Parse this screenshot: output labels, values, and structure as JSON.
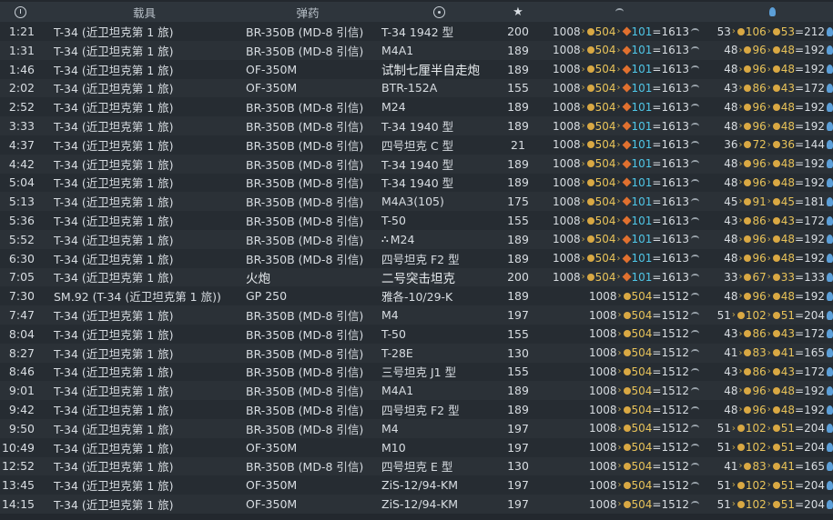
{
  "headers": {
    "vehicle": "载具",
    "ammo": "弹药"
  },
  "icons": {
    "time": "clock-icon",
    "target": "crosshair-icon",
    "score": "star-icon",
    "silver": "eagle-icon",
    "research": "lightbulb-icon"
  },
  "colors": {
    "bg": "#23282e",
    "silver_coin": "#d9a843",
    "premium": "#e0702f",
    "blue_bonus": "#4fc7e8"
  },
  "rows": [
    {
      "time": "1:21",
      "vehicle": "T-34 (近卫坦克第 1 旅)",
      "ammo": "BR-350B (MD-8 引信)",
      "target": "T-34 1942 型",
      "score": "200",
      "sl_base": "1008",
      "sl_bonus": "504",
      "sl_prem": "101",
      "sl_total": "=1613",
      "rp_base": "53",
      "rp_bonus": "106",
      "rp_prem": "53",
      "rp_total": "=212"
    },
    {
      "time": "1:31",
      "vehicle": "T-34 (近卫坦克第 1 旅)",
      "ammo": "BR-350B (MD-8 引信)",
      "target": "M4A1",
      "score": "189",
      "sl_base": "1008",
      "sl_bonus": "504",
      "sl_prem": "101",
      "sl_total": "=1613",
      "rp_base": "48",
      "rp_bonus": "96",
      "rp_prem": "48",
      "rp_total": "=192"
    },
    {
      "time": "1:46",
      "vehicle": "T-34 (近卫坦克第 1 旅)",
      "ammo": "OF-350M",
      "target": "试制七厘半自走炮",
      "big": true,
      "score": "189",
      "sl_base": "1008",
      "sl_bonus": "504",
      "sl_prem": "101",
      "sl_total": "=1613",
      "rp_base": "48",
      "rp_bonus": "96",
      "rp_prem": "48",
      "rp_total": "=192"
    },
    {
      "time": "2:02",
      "vehicle": "T-34 (近卫坦克第 1 旅)",
      "ammo": "OF-350M",
      "target": "BTR-152A",
      "score": "155",
      "sl_base": "1008",
      "sl_bonus": "504",
      "sl_prem": "101",
      "sl_total": "=1613",
      "rp_base": "43",
      "rp_bonus": "86",
      "rp_prem": "43",
      "rp_total": "=172"
    },
    {
      "time": "2:52",
      "vehicle": "T-34 (近卫坦克第 1 旅)",
      "ammo": "BR-350B (MD-8 引信)",
      "target": "M24",
      "score": "189",
      "sl_base": "1008",
      "sl_bonus": "504",
      "sl_prem": "101",
      "sl_total": "=1613",
      "rp_base": "48",
      "rp_bonus": "96",
      "rp_prem": "48",
      "rp_total": "=192"
    },
    {
      "time": "3:33",
      "vehicle": "T-34 (近卫坦克第 1 旅)",
      "ammo": "BR-350B (MD-8 引信)",
      "target": "T-34 1940 型",
      "score": "189",
      "sl_base": "1008",
      "sl_bonus": "504",
      "sl_prem": "101",
      "sl_total": "=1613",
      "rp_base": "48",
      "rp_bonus": "96",
      "rp_prem": "48",
      "rp_total": "=192"
    },
    {
      "time": "4:37",
      "vehicle": "T-34 (近卫坦克第 1 旅)",
      "ammo": "BR-350B (MD-8 引信)",
      "target": "四号坦克 C 型",
      "score": "21",
      "sl_base": "1008",
      "sl_bonus": "504",
      "sl_prem": "101",
      "sl_total": "=1613",
      "rp_base": "36",
      "rp_bonus": "72",
      "rp_prem": "36",
      "rp_total": "=144"
    },
    {
      "time": "4:42",
      "vehicle": "T-34 (近卫坦克第 1 旅)",
      "ammo": "BR-350B (MD-8 引信)",
      "target": "T-34 1940 型",
      "score": "189",
      "sl_base": "1008",
      "sl_bonus": "504",
      "sl_prem": "101",
      "sl_total": "=1613",
      "rp_base": "48",
      "rp_bonus": "96",
      "rp_prem": "48",
      "rp_total": "=192"
    },
    {
      "time": "5:04",
      "vehicle": "T-34 (近卫坦克第 1 旅)",
      "ammo": "BR-350B (MD-8 引信)",
      "target": "T-34 1940 型",
      "score": "189",
      "sl_base": "1008",
      "sl_bonus": "504",
      "sl_prem": "101",
      "sl_total": "=1613",
      "rp_base": "48",
      "rp_bonus": "96",
      "rp_prem": "48",
      "rp_total": "=192"
    },
    {
      "time": "5:13",
      "vehicle": "T-34 (近卫坦克第 1 旅)",
      "ammo": "BR-350B (MD-8 引信)",
      "target": "M4A3(105)",
      "score": "175",
      "sl_base": "1008",
      "sl_bonus": "504",
      "sl_prem": "101",
      "sl_total": "=1613",
      "rp_base": "45",
      "rp_bonus": "91",
      "rp_prem": "45",
      "rp_total": "=181"
    },
    {
      "time": "5:36",
      "vehicle": "T-34 (近卫坦克第 1 旅)",
      "ammo": "BR-350B (MD-8 引信)",
      "target": "T-50",
      "score": "155",
      "sl_base": "1008",
      "sl_bonus": "504",
      "sl_prem": "101",
      "sl_total": "=1613",
      "rp_base": "43",
      "rp_bonus": "86",
      "rp_prem": "43",
      "rp_total": "=172"
    },
    {
      "time": "5:52",
      "vehicle": "T-34 (近卫坦克第 1 旅)",
      "ammo": "BR-350B (MD-8 引信)",
      "target": "M24",
      "emblem": true,
      "score": "189",
      "sl_base": "1008",
      "sl_bonus": "504",
      "sl_prem": "101",
      "sl_total": "=1613",
      "rp_base": "48",
      "rp_bonus": "96",
      "rp_prem": "48",
      "rp_total": "=192"
    },
    {
      "time": "6:30",
      "vehicle": "T-34 (近卫坦克第 1 旅)",
      "ammo": "BR-350B (MD-8 引信)",
      "target": "四号坦克 F2 型",
      "score": "189",
      "sl_base": "1008",
      "sl_bonus": "504",
      "sl_prem": "101",
      "sl_total": "=1613",
      "rp_base": "48",
      "rp_bonus": "96",
      "rp_prem": "48",
      "rp_total": "=192"
    },
    {
      "time": "7:05",
      "vehicle": "T-34 (近卫坦克第 1 旅)",
      "ammo": "火炮",
      "ammo_big": true,
      "target": "二号突击坦克",
      "big": true,
      "score": "200",
      "sl_base": "1008",
      "sl_bonus": "504",
      "sl_prem": "101",
      "sl_total": "=1613",
      "rp_base": "33",
      "rp_bonus": "67",
      "rp_prem": "33",
      "rp_total": "=133"
    },
    {
      "time": "7:30",
      "vehicle": "SM.92 (T-34 (近卫坦克第 1 旅))",
      "ammo": "GP 250",
      "target": "雅各-10/29-K",
      "score": "189",
      "sl_base": "1008",
      "sl_bonus": "504",
      "sl_total": "=1512",
      "rp_base": "48",
      "rp_bonus": "96",
      "rp_prem": "48",
      "rp_total": "=192"
    },
    {
      "time": "7:47",
      "vehicle": "T-34 (近卫坦克第 1 旅)",
      "ammo": "BR-350B (MD-8 引信)",
      "target": "M4",
      "score": "197",
      "sl_base": "1008",
      "sl_bonus": "504",
      "sl_total": "=1512",
      "rp_base": "51",
      "rp_bonus": "102",
      "rp_prem": "51",
      "rp_total": "=204"
    },
    {
      "time": "8:04",
      "vehicle": "T-34 (近卫坦克第 1 旅)",
      "ammo": "BR-350B (MD-8 引信)",
      "target": "T-50",
      "score": "155",
      "sl_base": "1008",
      "sl_bonus": "504",
      "sl_total": "=1512",
      "rp_base": "43",
      "rp_bonus": "86",
      "rp_prem": "43",
      "rp_total": "=172"
    },
    {
      "time": "8:27",
      "vehicle": "T-34 (近卫坦克第 1 旅)",
      "ammo": "BR-350B (MD-8 引信)",
      "target": "T-28E",
      "score": "130",
      "sl_base": "1008",
      "sl_bonus": "504",
      "sl_total": "=1512",
      "rp_base": "41",
      "rp_bonus": "83",
      "rp_prem": "41",
      "rp_total": "=165"
    },
    {
      "time": "8:46",
      "vehicle": "T-34 (近卫坦克第 1 旅)",
      "ammo": "BR-350B (MD-8 引信)",
      "target": "三号坦克 J1 型",
      "score": "155",
      "sl_base": "1008",
      "sl_bonus": "504",
      "sl_total": "=1512",
      "rp_base": "43",
      "rp_bonus": "86",
      "rp_prem": "43",
      "rp_total": "=172"
    },
    {
      "time": "9:01",
      "vehicle": "T-34 (近卫坦克第 1 旅)",
      "ammo": "BR-350B (MD-8 引信)",
      "target": "M4A1",
      "score": "189",
      "sl_base": "1008",
      "sl_bonus": "504",
      "sl_total": "=1512",
      "rp_base": "48",
      "rp_bonus": "96",
      "rp_prem": "48",
      "rp_total": "=192"
    },
    {
      "time": "9:42",
      "vehicle": "T-34 (近卫坦克第 1 旅)",
      "ammo": "BR-350B (MD-8 引信)",
      "target": "四号坦克 F2 型",
      "score": "189",
      "sl_base": "1008",
      "sl_bonus": "504",
      "sl_total": "=1512",
      "rp_base": "48",
      "rp_bonus": "96",
      "rp_prem": "48",
      "rp_total": "=192"
    },
    {
      "time": "9:50",
      "vehicle": "T-34 (近卫坦克第 1 旅)",
      "ammo": "BR-350B (MD-8 引信)",
      "target": "M4",
      "score": "197",
      "sl_base": "1008",
      "sl_bonus": "504",
      "sl_total": "=1512",
      "rp_base": "51",
      "rp_bonus": "102",
      "rp_prem": "51",
      "rp_total": "=204"
    },
    {
      "time": "10:49",
      "vehicle": "T-34 (近卫坦克第 1 旅)",
      "ammo": "OF-350M",
      "target": "M10",
      "score": "197",
      "sl_base": "1008",
      "sl_bonus": "504",
      "sl_total": "=1512",
      "rp_base": "51",
      "rp_bonus": "102",
      "rp_prem": "51",
      "rp_total": "=204"
    },
    {
      "time": "12:52",
      "vehicle": "T-34 (近卫坦克第 1 旅)",
      "ammo": "BR-350B (MD-8 引信)",
      "target": "四号坦克 E 型",
      "score": "130",
      "sl_base": "1008",
      "sl_bonus": "504",
      "sl_total": "=1512",
      "rp_base": "41",
      "rp_bonus": "83",
      "rp_prem": "41",
      "rp_total": "=165"
    },
    {
      "time": "13:45",
      "vehicle": "T-34 (近卫坦克第 1 旅)",
      "ammo": "OF-350M",
      "target": "ZiS-12/94-KM",
      "score": "197",
      "sl_base": "1008",
      "sl_bonus": "504",
      "sl_total": "=1512",
      "rp_base": "51",
      "rp_bonus": "102",
      "rp_prem": "51",
      "rp_total": "=204"
    },
    {
      "time": "14:15",
      "vehicle": "T-34 (近卫坦克第 1 旅)",
      "ammo": "OF-350M",
      "target": "ZiS-12/94-KM",
      "score": "197",
      "sl_base": "1008",
      "sl_bonus": "504",
      "sl_total": "=1512",
      "rp_base": "51",
      "rp_bonus": "102",
      "rp_prem": "51",
      "rp_total": "=204"
    }
  ]
}
